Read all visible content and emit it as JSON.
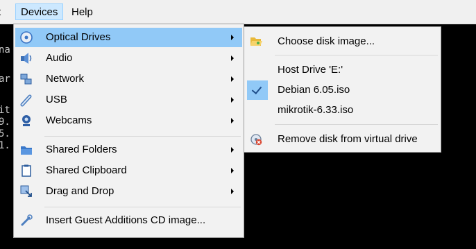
{
  "menubar": {
    "partial_left": "t",
    "devices": "Devices",
    "help": "Help"
  },
  "console": {
    "lines": [
      "na",
      "ar",
      "it",
      "9.",
      "5.",
      "1."
    ]
  },
  "devices_menu": {
    "items": [
      {
        "label": "Optical Drives",
        "icon": "optical-disc-icon",
        "submenu": true,
        "highlighted": true
      },
      {
        "label": "Audio",
        "icon": "audio-icon",
        "submenu": true
      },
      {
        "label": "Network",
        "icon": "network-icon",
        "submenu": true
      },
      {
        "label": "USB",
        "icon": "usb-icon",
        "submenu": true
      },
      {
        "label": "Webcams",
        "icon": "webcam-icon",
        "submenu": true
      },
      {
        "label": "Shared Folders",
        "icon": "folder-icon",
        "submenu": true
      },
      {
        "label": "Shared Clipboard",
        "icon": "clipboard-icon",
        "submenu": true
      },
      {
        "label": "Drag and Drop",
        "icon": "drag-drop-icon",
        "submenu": true
      },
      {
        "label": "Insert Guest Additions CD image...",
        "icon": "cd-insert-icon",
        "submenu": false
      }
    ]
  },
  "optical_submenu": {
    "items": [
      {
        "label": "Choose disk image...",
        "icon": "folder-open-icon"
      },
      {
        "label": "Host Drive 'E:'"
      },
      {
        "label": "Debian 6.05.iso",
        "checked": true
      },
      {
        "label": "mikrotik-6.33.iso"
      },
      {
        "label": "Remove disk from virtual drive",
        "icon": "remove-disk-icon"
      }
    ]
  },
  "colors": {
    "highlight": "#91c9f7",
    "menu_bg": "#f2f2f2",
    "menubar_active": "#cce8ff"
  }
}
